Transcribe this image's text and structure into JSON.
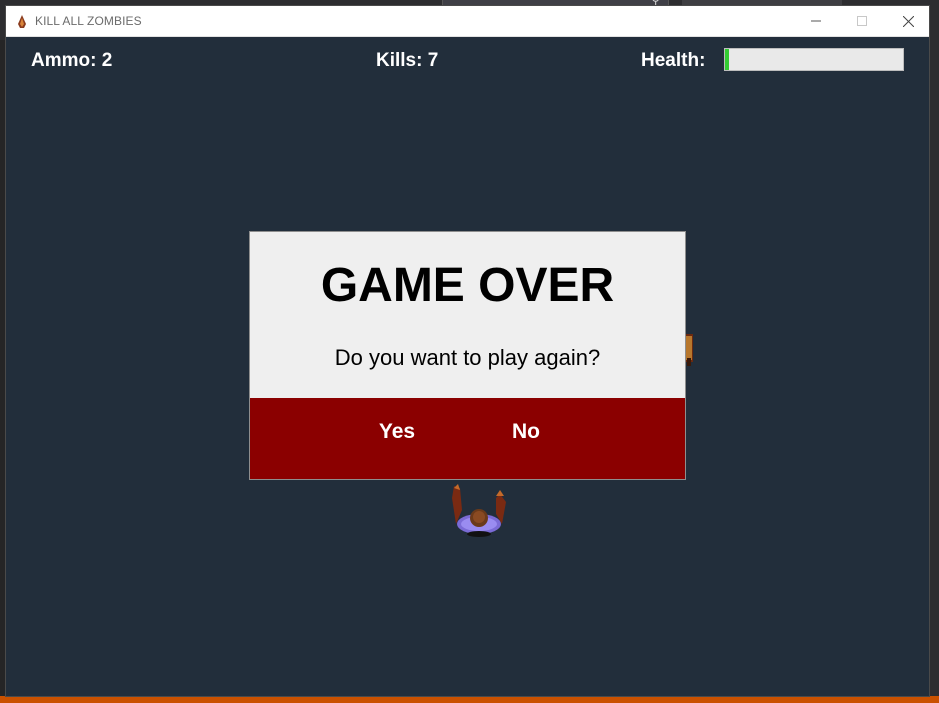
{
  "window": {
    "title": "KILL ALL ZOMBIES",
    "controls": [
      "minimize",
      "maximize",
      "close"
    ]
  },
  "hud": {
    "ammo": "Ammo: 2",
    "kills": "Kills: 7",
    "health_label": "Health:",
    "health_fraction": 0.02
  },
  "dialog": {
    "title": "GAME OVER",
    "question": "Do you want to play again?",
    "yes_label": "Yes",
    "no_label": "No"
  },
  "colors": {
    "game_background": "#222e3b",
    "dialog_panel": "#efefef",
    "dialog_button_bar": "#8b0000",
    "health_fill": "#33cc33",
    "health_track": "#e9e9e9"
  }
}
